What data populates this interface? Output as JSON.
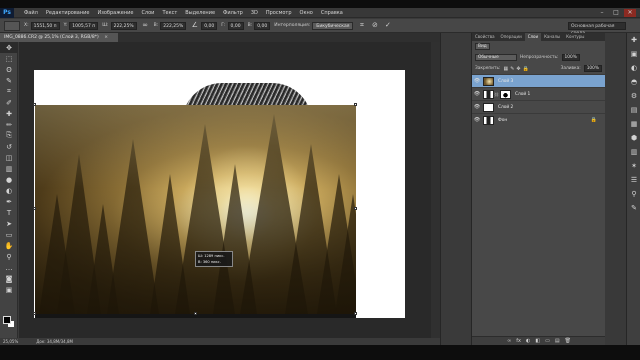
{
  "app": {
    "logo": "Ps"
  },
  "menu": [
    "Файл",
    "Редактирование",
    "Изображение",
    "Слои",
    "Текст",
    "Выделение",
    "Фильтр",
    "3D",
    "Просмотр",
    "Окно",
    "Справка"
  ],
  "window_controls": {
    "minimize": "–",
    "maximize": "□",
    "close": "✕"
  },
  "options": {
    "x_label": "X:",
    "x_value": "1551,50 п",
    "y_label": "Y:",
    "y_value": "1005,57 п",
    "w_label": "Ш:",
    "w_value": "222,25%",
    "h_label": "В:",
    "h_value": "222,25%",
    "angle_value": "0,00",
    "hskew_label": "Г:",
    "hskew_value": "0,00",
    "vskew_label": "В:",
    "vskew_value": "0,00",
    "interp_label": "Интерполяция:",
    "interp_value": "Бикубическая",
    "mode": "Интерполяция",
    "workspace": "Основная рабочая среда"
  },
  "document_tab": {
    "label": "IMG_0886.CR2 @ 25,1% (Слой 3, RGB/8*)",
    "close": "×"
  },
  "tools": [
    "move-tool",
    "marquee-tool",
    "lasso-tool",
    "quick-select-tool",
    "crop-tool",
    "eyedropper-tool",
    "healing-tool",
    "brush-tool",
    "clone-tool",
    "history-brush-tool",
    "eraser-tool",
    "gradient-tool",
    "blur-tool",
    "dodge-tool",
    "pen-tool",
    "type-tool",
    "path-select-tool",
    "shape-tool",
    "hand-tool",
    "zoom-tool",
    "extra-tool",
    "quickmask-tool",
    "screen-mode-tool"
  ],
  "tool_glyphs": [
    "✥",
    "⬚",
    "ʘ",
    "✎",
    "⌗",
    "✐",
    "✚",
    "✏",
    "⎘",
    "↺",
    "◫",
    "▥",
    "●",
    "◐",
    "✒",
    "T",
    "➤",
    "▭",
    "✋",
    "⚲",
    "…",
    "◙",
    "▣"
  ],
  "tooltip": {
    "w": "Ш: 1289 пикс.",
    "h": "В: 360 пикс."
  },
  "status": {
    "zoom": "25,05%",
    "doc": "Док: 34,8М/34,8М"
  },
  "panel_tabs": [
    "Свойства",
    "Операции",
    "Слои",
    "Каналы",
    "Контуры"
  ],
  "layers_panel": {
    "filter_label": "Вид",
    "blend_mode": "Обычные",
    "opacity_label": "Непрозрачность:",
    "opacity_value": "100%",
    "lock_label": "Закрепить:",
    "fill_label": "Заливка:",
    "fill_value": "100%",
    "footer": [
      "∞",
      "fx",
      "◐",
      "◧",
      "▭",
      "▤",
      "🗑"
    ],
    "layers": [
      {
        "name": "Слой 3",
        "thumb": "photo",
        "selected": true,
        "mask": false,
        "lock": false
      },
      {
        "name": "Слой 1",
        "thumb": "face",
        "selected": false,
        "mask": true,
        "lock": false
      },
      {
        "name": "Слой 2",
        "thumb": "white",
        "selected": false,
        "mask": false,
        "lock": false
      },
      {
        "name": "Фон",
        "thumb": "face",
        "selected": false,
        "mask": false,
        "lock": true
      }
    ]
  },
  "right_icons": [
    "✚",
    "▣",
    "◐",
    "◓",
    "⚙",
    "▤",
    "▦",
    "⬢",
    "▥",
    "✶",
    "☰",
    "⚲",
    "✎"
  ]
}
